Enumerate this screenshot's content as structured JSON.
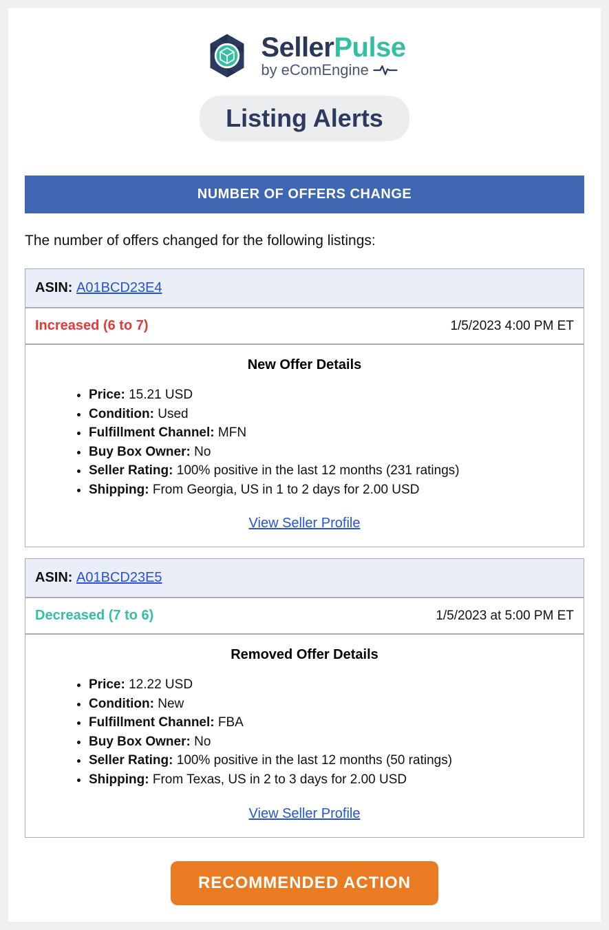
{
  "brand": {
    "name_part1": "Seller",
    "name_part2": "Pulse",
    "subline_by": "by",
    "subline_name": "eComEngine"
  },
  "page_title": "Listing Alerts",
  "section_header": "NUMBER OF OFFERS CHANGE",
  "intro": "The number of offers changed for the following listings:",
  "asin_label": "ASIN:",
  "profile_link_text": "View Seller Profile",
  "detail_labels": {
    "price": "Price:",
    "condition": "Condition:",
    "fulfillment": "Fulfillment Channel:",
    "buybox": "Buy Box Owner:",
    "rating": "Seller Rating:",
    "shipping": "Shipping:"
  },
  "listings": [
    {
      "asin": "A01BCD23E4",
      "status_kind": "increased",
      "status_text": "Increased (6 to 7)",
      "timestamp": "1/5/2023 4:00 PM ET",
      "details_title": "New Offer Details",
      "price": "15.21 USD",
      "condition": "Used",
      "fulfillment": "MFN",
      "buybox": "No",
      "rating": "100% positive in the last 12 months (231 ratings)",
      "shipping": "From Georgia, US in 1 to 2 days for 2.00 USD"
    },
    {
      "asin": "A01BCD23E5",
      "status_kind": "decreased",
      "status_text": "Decreased (7 to 6)",
      "timestamp": "1/5/2023 at 5:00 PM ET",
      "details_title": "Removed Offer Details",
      "price": "12.22 USD",
      "condition": "New",
      "fulfillment": "FBA",
      "buybox": "No",
      "rating": "100% positive in the last 12 months (50 ratings)",
      "shipping": "From Texas, US in 2 to 3 days for 2.00 USD"
    }
  ],
  "cta_label": "RECOMMENDED ACTION"
}
